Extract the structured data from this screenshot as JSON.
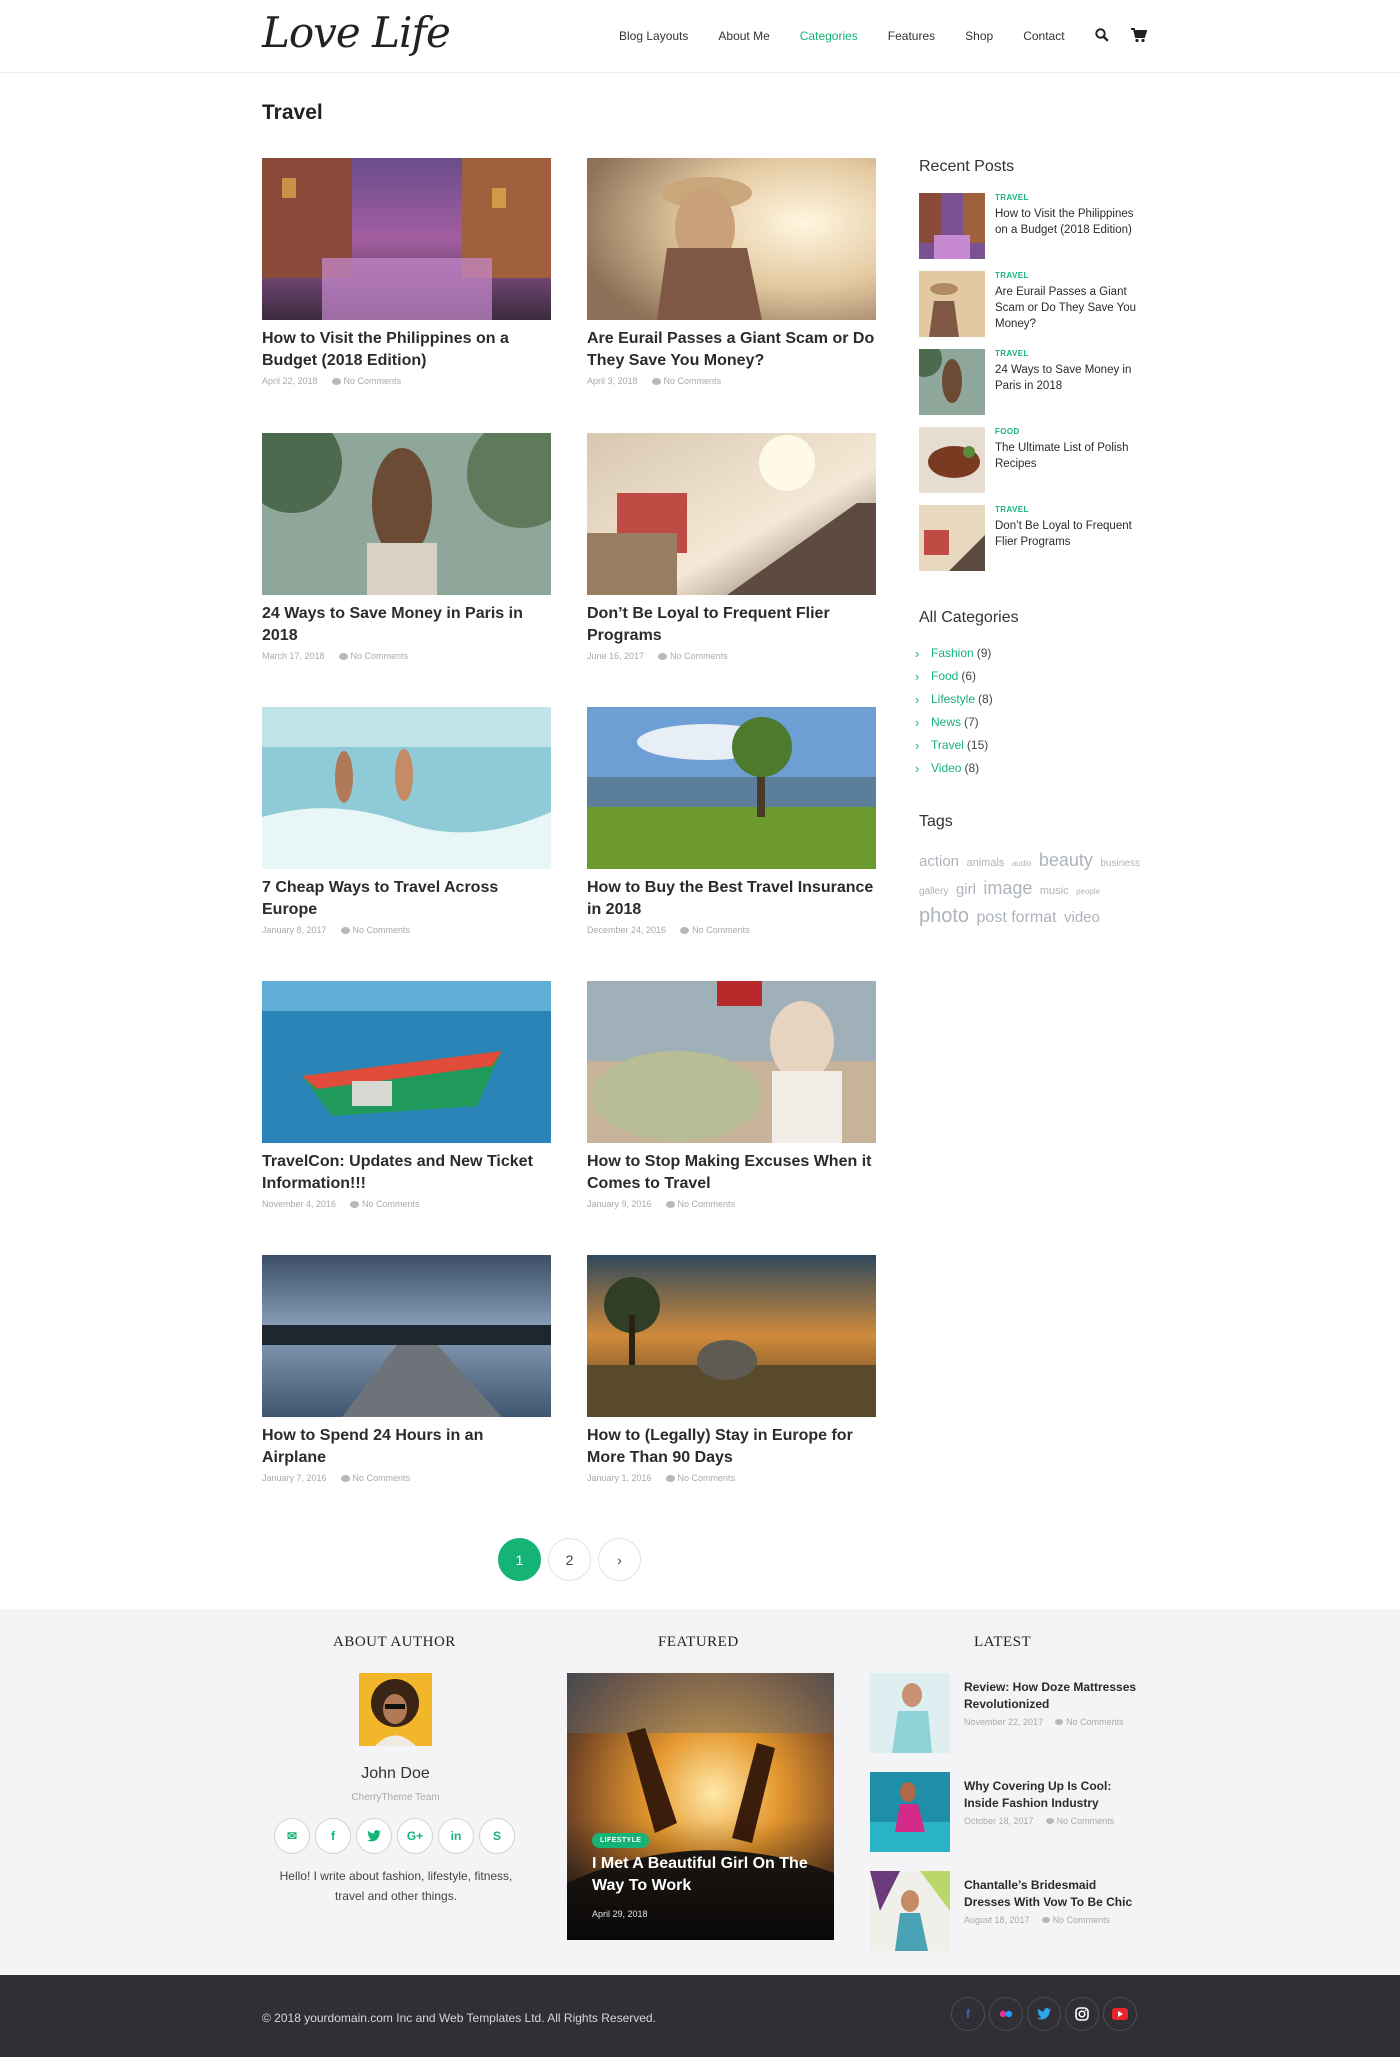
{
  "header": {
    "logo": "Love Life",
    "nav": [
      "Blog Layouts",
      "About Me",
      "Categories",
      "Features",
      "Shop",
      "Contact"
    ],
    "active_nav": "Categories"
  },
  "page_title": "Travel",
  "posts": [
    {
      "title": "How to Visit the Philippines on a Budget (2018 Edition)",
      "date": "April 22, 2018",
      "comments": "No Comments"
    },
    {
      "title": "Are Eurail Passes a Giant Scam or Do They Save You Money?",
      "date": "April 3, 2018",
      "comments": "No Comments"
    },
    {
      "title": "24 Ways to Save Money in Paris in 2018",
      "date": "March 17, 2018",
      "comments": "No Comments"
    },
    {
      "title": "Don’t Be Loyal to Frequent Flier Programs",
      "date": "June 16, 2017",
      "comments": "No Comments"
    },
    {
      "title": "7 Cheap Ways to Travel Across Europe",
      "date": "January 8, 2017",
      "comments": "No Comments"
    },
    {
      "title": "How to Buy the Best Travel Insurance in 2018",
      "date": "December 24, 2016",
      "comments": "No Comments"
    },
    {
      "title": "TravelCon: Updates and New Ticket Information!!!",
      "date": "November 4, 2016",
      "comments": "No Comments"
    },
    {
      "title": "How to Stop Making Excuses When it Comes to Travel",
      "date": "January 9, 2016",
      "comments": "No Comments"
    },
    {
      "title": "How to Spend 24 Hours in an Airplane",
      "date": "January 7, 2016",
      "comments": "No Comments"
    },
    {
      "title": "How to (Legally) Stay in Europe for More Than 90 Days",
      "date": "January 1, 2016",
      "comments": "No Comments"
    }
  ],
  "sidebar": {
    "recent_heading": "Recent Posts",
    "recent": [
      {
        "cat": "TRAVEL",
        "title": "How to Visit the Philippines on a Budget (2018 Edition)"
      },
      {
        "cat": "TRAVEL",
        "title": "Are Eurail Passes a Giant Scam or Do They Save You Money?"
      },
      {
        "cat": "TRAVEL",
        "title": "24 Ways to Save Money in Paris in 2018"
      },
      {
        "cat": "FOOD",
        "title": "The Ultimate List of Polish Recipes"
      },
      {
        "cat": "TRAVEL",
        "title": "Don’t Be Loyal to Frequent Flier Programs"
      }
    ],
    "categories_heading": "All Categories",
    "categories": [
      {
        "name": "Fashion",
        "count": "(9)"
      },
      {
        "name": "Food",
        "count": "(6)"
      },
      {
        "name": "Lifestyle",
        "count": "(8)"
      },
      {
        "name": "News",
        "count": "(7)"
      },
      {
        "name": "Travel",
        "count": "(15)"
      },
      {
        "name": "Video",
        "count": "(8)"
      }
    ],
    "tags_heading": "Tags",
    "tags": [
      "action",
      "animals",
      "audio",
      "beauty",
      "business",
      "gallery",
      "girl",
      "image",
      "music",
      "people",
      "photo",
      "post format",
      "video"
    ]
  },
  "pagination": {
    "pages": [
      "1",
      "2"
    ],
    "next": "›",
    "current": "1"
  },
  "footer": {
    "about_heading": "ABOUT AUTHOR",
    "featured_heading": "FEATURED",
    "latest_heading": "LATEST",
    "author_name": "John Doe",
    "author_team": "CherryTheme Team",
    "author_bio": "Hello! I write about fashion, lifestyle, fitness, travel and other things.",
    "author_socials": [
      "email-icon",
      "facebook-icon",
      "twitter-icon",
      "google-plus-icon",
      "linkedin-icon",
      "skype-icon"
    ],
    "featured": {
      "badge": "LIFESTYLE",
      "title": "I Met A Beautiful Girl On The Way To Work",
      "date": "April 29, 2018"
    },
    "latest": [
      {
        "title": "Review: How Doze Mattresses Revolutionized",
        "date": "November 22, 2017",
        "comments": "No Comments"
      },
      {
        "title": "Why Covering Up Is Cool: Inside Fashion Industry",
        "date": "October 18, 2017",
        "comments": "No Comments"
      },
      {
        "title": "Chantalle’s Bridesmaid Dresses With Vow To Be Chic",
        "date": "August 18, 2017",
        "comments": "No Comments"
      }
    ],
    "copyright": "© 2018 yourdomain.com Inc and Web Templates Ltd. All Rights Reserved.",
    "bottom_socials": [
      "facebook-icon",
      "flickr-icon",
      "twitter-icon",
      "instagram-icon",
      "youtube-icon"
    ]
  },
  "colors": {
    "accent": "#16b377",
    "footer_dark": "#2f2f35",
    "footer_light": "#f4f4f6"
  }
}
